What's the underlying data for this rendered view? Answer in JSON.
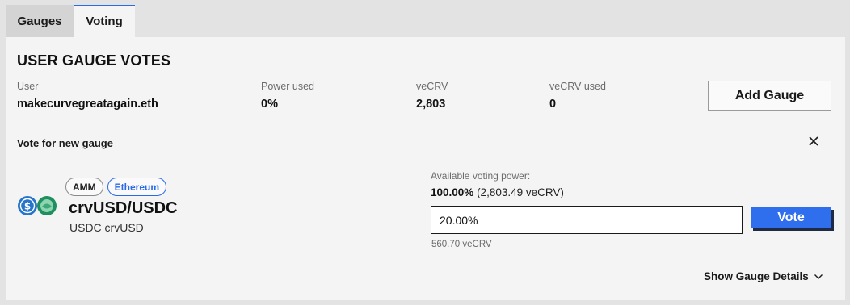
{
  "tabs": [
    {
      "label": "Gauges",
      "active": false
    },
    {
      "label": "Voting",
      "active": true
    }
  ],
  "panel": {
    "title": "USER GAUGE VOTES",
    "stats": [
      {
        "label": "User",
        "value": "makecurvegreatagain.eth"
      },
      {
        "label": "Power used",
        "value": "0%"
      },
      {
        "label": "veCRV",
        "value": "2,803"
      },
      {
        "label": "veCRV used",
        "value": "0"
      }
    ],
    "add_gauge_label": "Add Gauge"
  },
  "vote": {
    "title": "Vote for new gauge",
    "close_icon": "close-icon",
    "badges": {
      "type": "AMM",
      "network": "Ethereum"
    },
    "pool_name": "crvUSD/USDC",
    "pool_sub": "USDC crvUSD",
    "available_label": "Available voting power:",
    "available_pct": "100.00%",
    "available_amount": "(2,803.49 veCRV)",
    "input_value": "20.00%",
    "vote_label": "Vote",
    "vecrv_amount": "560.70 veCRV",
    "details_label": "Show Gauge Details",
    "details_icon": "chevron-down-icon"
  },
  "colors": {
    "accent": "#2f6fee",
    "ethereum_badge": "#2a6ae9",
    "usdc_coin": "#2775ca",
    "crvusd_coin": "#1f8f5f",
    "panel_bg": "#f4f4f4",
    "page_bg": "#e3e3e3"
  }
}
